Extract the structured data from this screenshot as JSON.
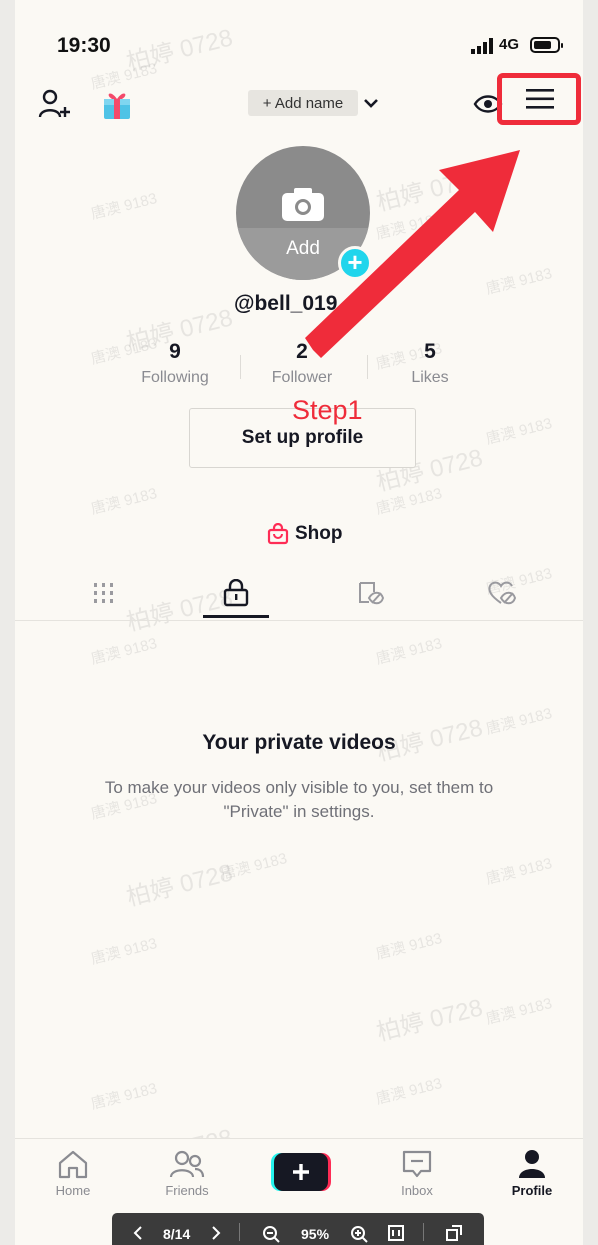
{
  "status_bar": {
    "time": "19:30",
    "network": "4G",
    "battery_level": 0.75
  },
  "header": {
    "add_name_label": "+ Add name",
    "icons": [
      "add-user-icon",
      "gift-icon",
      "chevron-down-icon",
      "eye-icon",
      "menu-icon"
    ]
  },
  "profile": {
    "avatar_add_label": "Add",
    "username": "@bell_019",
    "stats": [
      {
        "value": "9",
        "label": "Following"
      },
      {
        "value": "2",
        "label": "Follower"
      },
      {
        "value": "5",
        "label": "Likes"
      }
    ],
    "setup_button": "Set up profile",
    "shop_label": "Shop"
  },
  "content_tabs": [
    "videos-grid-icon",
    "private-lock-icon",
    "reposts-icon",
    "liked-icon"
  ],
  "empty_state": {
    "title": "Your private videos",
    "description": "To make your videos only visible to you, set them to \"Private\" in settings."
  },
  "annotation": {
    "step_label": "Step1",
    "color": "#ef2c3a"
  },
  "watermarks": {
    "large": "柏婷 0728",
    "small": "唐澳 9183"
  },
  "bottom_nav": [
    {
      "label": "Home",
      "icon": "home-icon"
    },
    {
      "label": "Friends",
      "icon": "friends-icon"
    },
    {
      "label": "",
      "icon": "create-plus-icon"
    },
    {
      "label": "Inbox",
      "icon": "inbox-icon"
    },
    {
      "label": "Profile",
      "icon": "profile-icon",
      "active": true
    }
  ],
  "viewer_toolbar": {
    "page": "8/14",
    "zoom": "95%"
  }
}
